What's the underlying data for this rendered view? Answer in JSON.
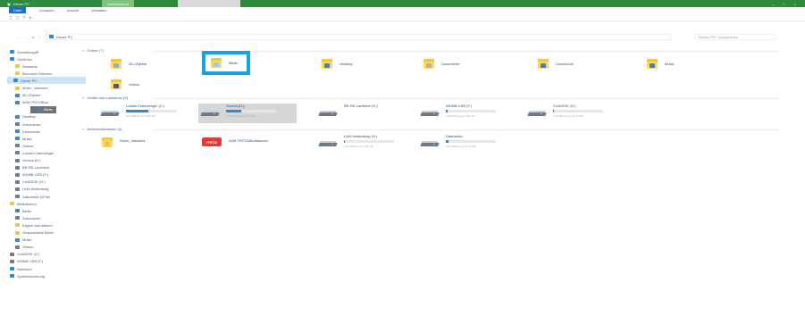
{
  "window": {
    "title": "Dieser PC",
    "accent_tab": "Laufwerktools",
    "controls": [
      "–",
      "□",
      "×"
    ]
  },
  "ribbon": {
    "tabs": [
      "Datei",
      "Computer",
      "Ansicht",
      "Verwalten"
    ],
    "active_tab_index": 0,
    "quick_tools": [
      "▢",
      "▢",
      "↶",
      "▾"
    ]
  },
  "address": {
    "nav": [
      "←",
      "→",
      "▾",
      "↑"
    ],
    "path": "Dieser PC",
    "search_placeholder": "\"Dieser PC\" durchsuchen"
  },
  "sidebar": {
    "items": [
      {
        "label": "Schnellzugriff",
        "icon": "star-icon",
        "color": "#2b8ad8"
      },
      {
        "label": "OneDrive",
        "icon": "cloud-icon",
        "color": "#2b8ad8"
      },
      {
        "label": "Amadeus",
        "icon": "folder-icon",
        "color": "#f2c443"
      },
      {
        "label": "Bernhard Zimmern",
        "icon": "user-icon",
        "color": "#f2c443"
      },
      {
        "label": "Dieser PC",
        "icon": "pc-icon",
        "color": "#2b8ad8"
      },
      {
        "label": "Wohn_netzwerk",
        "icon": "folder-icon",
        "color": "#f2c443"
      },
      {
        "label": "3D-Objekte",
        "icon": "cube-icon",
        "color": "#2b8ad8"
      },
      {
        "label": "AVM FRITZ!Box",
        "icon": "folder-icon",
        "color": "#2b8ad8"
      },
      {
        "label": "Bilder",
        "icon": "pictures-icon",
        "color": "#2b8ad8"
      },
      {
        "label": "Desktop",
        "icon": "desktop-icon",
        "color": "#2b8ad8"
      },
      {
        "label": "Dokumente",
        "icon": "documents-icon",
        "color": "#6c7a89"
      },
      {
        "label": "Downloads",
        "icon": "downloads-icon",
        "color": "#2b8ad8"
      },
      {
        "label": "Musik",
        "icon": "music-icon",
        "color": "#2b8ad8"
      },
      {
        "label": "Videos",
        "icon": "videos-icon",
        "color": "#6c7a89"
      },
      {
        "label": "Lokaler Datenträger",
        "icon": "drive-icon",
        "color": "#6c7a89"
      },
      {
        "label": "Verona (D:)",
        "icon": "drive-icon",
        "color": "#6c7a89"
      },
      {
        "label": "BR-RE-Laufwerk",
        "icon": "disc-icon",
        "color": "#6c7a89"
      },
      {
        "label": "WDMB USB (F:)",
        "icon": "drive-icon",
        "color": "#6c7a89"
      },
      {
        "label": "CoolDISK (G:)",
        "icon": "drive-icon",
        "color": "#6c7a89"
      },
      {
        "label": "LAN-Verbindung",
        "icon": "network-drive-icon",
        "color": "#6c7a89"
      },
      {
        "label": "Datenstick (\\\\Fritz",
        "icon": "network-drive-icon",
        "color": "#6c7a89"
      },
      {
        "label": "Bibliotheken",
        "icon": "library-icon",
        "color": "#f2c443"
      },
      {
        "label": "Bilder",
        "icon": "pictures-icon",
        "color": "#2b8ad8"
      },
      {
        "label": "Dokumente",
        "icon": "documents-icon",
        "color": "#6c7a89"
      },
      {
        "label": "Eigene Aufnahmen",
        "icon": "folder-icon",
        "color": "#f2c443"
      },
      {
        "label": "Gespeicherte Bilder",
        "icon": "folder-icon",
        "color": "#f2c443"
      },
      {
        "label": "Musik",
        "icon": "music-icon",
        "color": "#2b8ad8"
      },
      {
        "label": "Videos",
        "icon": "videos-icon",
        "color": "#6c7a89"
      },
      {
        "label": "CoolDISK (G:)",
        "icon": "drive-icon",
        "color": "#6c7a89"
      },
      {
        "label": "WDMB USB (F:)",
        "icon": "drive-icon",
        "color": "#6c7a89"
      },
      {
        "label": "Netzwerk",
        "icon": "network-icon",
        "color": "#2b8ad8"
      },
      {
        "label": "Systemsteuerung",
        "icon": "control-panel-icon",
        "color": "#2b8ad8"
      }
    ],
    "selected_index": 4,
    "hover_index": 8
  },
  "content": {
    "groups": [
      "Ordner (7)",
      "Geräte und Laufwerke (5)",
      "Netzwerkadressen (4)"
    ],
    "folders": [
      {
        "label": "3D-Objekte",
        "badge": "#7fb2e5"
      },
      {
        "label": "Bilder",
        "badge": "#9ecae1"
      },
      {
        "label": "Desktop",
        "badge": "#2b8ad8"
      },
      {
        "label": "Dokumente",
        "badge": "#a9b4c0"
      },
      {
        "label": "Downloads",
        "badge": "#2b8ad8"
      },
      {
        "label": "Musik",
        "badge": "#2b8ad8"
      },
      {
        "label": "Videos",
        "badge": "#505a66"
      }
    ],
    "drives": [
      {
        "name": "Lokaler Datenträger (C:)",
        "info": "69,4 GB frei von 118 GB",
        "usage": 0.45
      },
      {
        "name": "Verona (D:)",
        "info": "1,28 TB frei von 1,81 TB",
        "usage": 0.3
      },
      {
        "name": "BR-RE-Laufwerk (E:)",
        "info": "",
        "usage": 0
      },
      {
        "name": "WDMB USB (F:)",
        "info": "1,84 TB frei von 1,86 TB",
        "usage": 0.03
      },
      {
        "name": "CoolDISK (G:)",
        "info": "3,73 GB frei von 3,73 GB",
        "usage": 0.02
      }
    ],
    "network": [
      {
        "name": "Wohn_netzwerk",
        "info": "",
        "usage": 0,
        "kind": "folder"
      },
      {
        "name": "AVM FRITZ!Mediaserver",
        "info": "",
        "usage": 0,
        "kind": "fritz"
      },
      {
        "name": "LAN-Verbindung (H:)",
        "info": "1,95 TB frei von 1,96 TB",
        "usage": 0.01,
        "kind": "drive"
      },
      {
        "name": "Datenstick",
        "info": "3,67 GB frei von 3,73 GB",
        "usage": 0.05,
        "kind": "drive"
      }
    ],
    "fritz_logo": "FRITZ!"
  }
}
